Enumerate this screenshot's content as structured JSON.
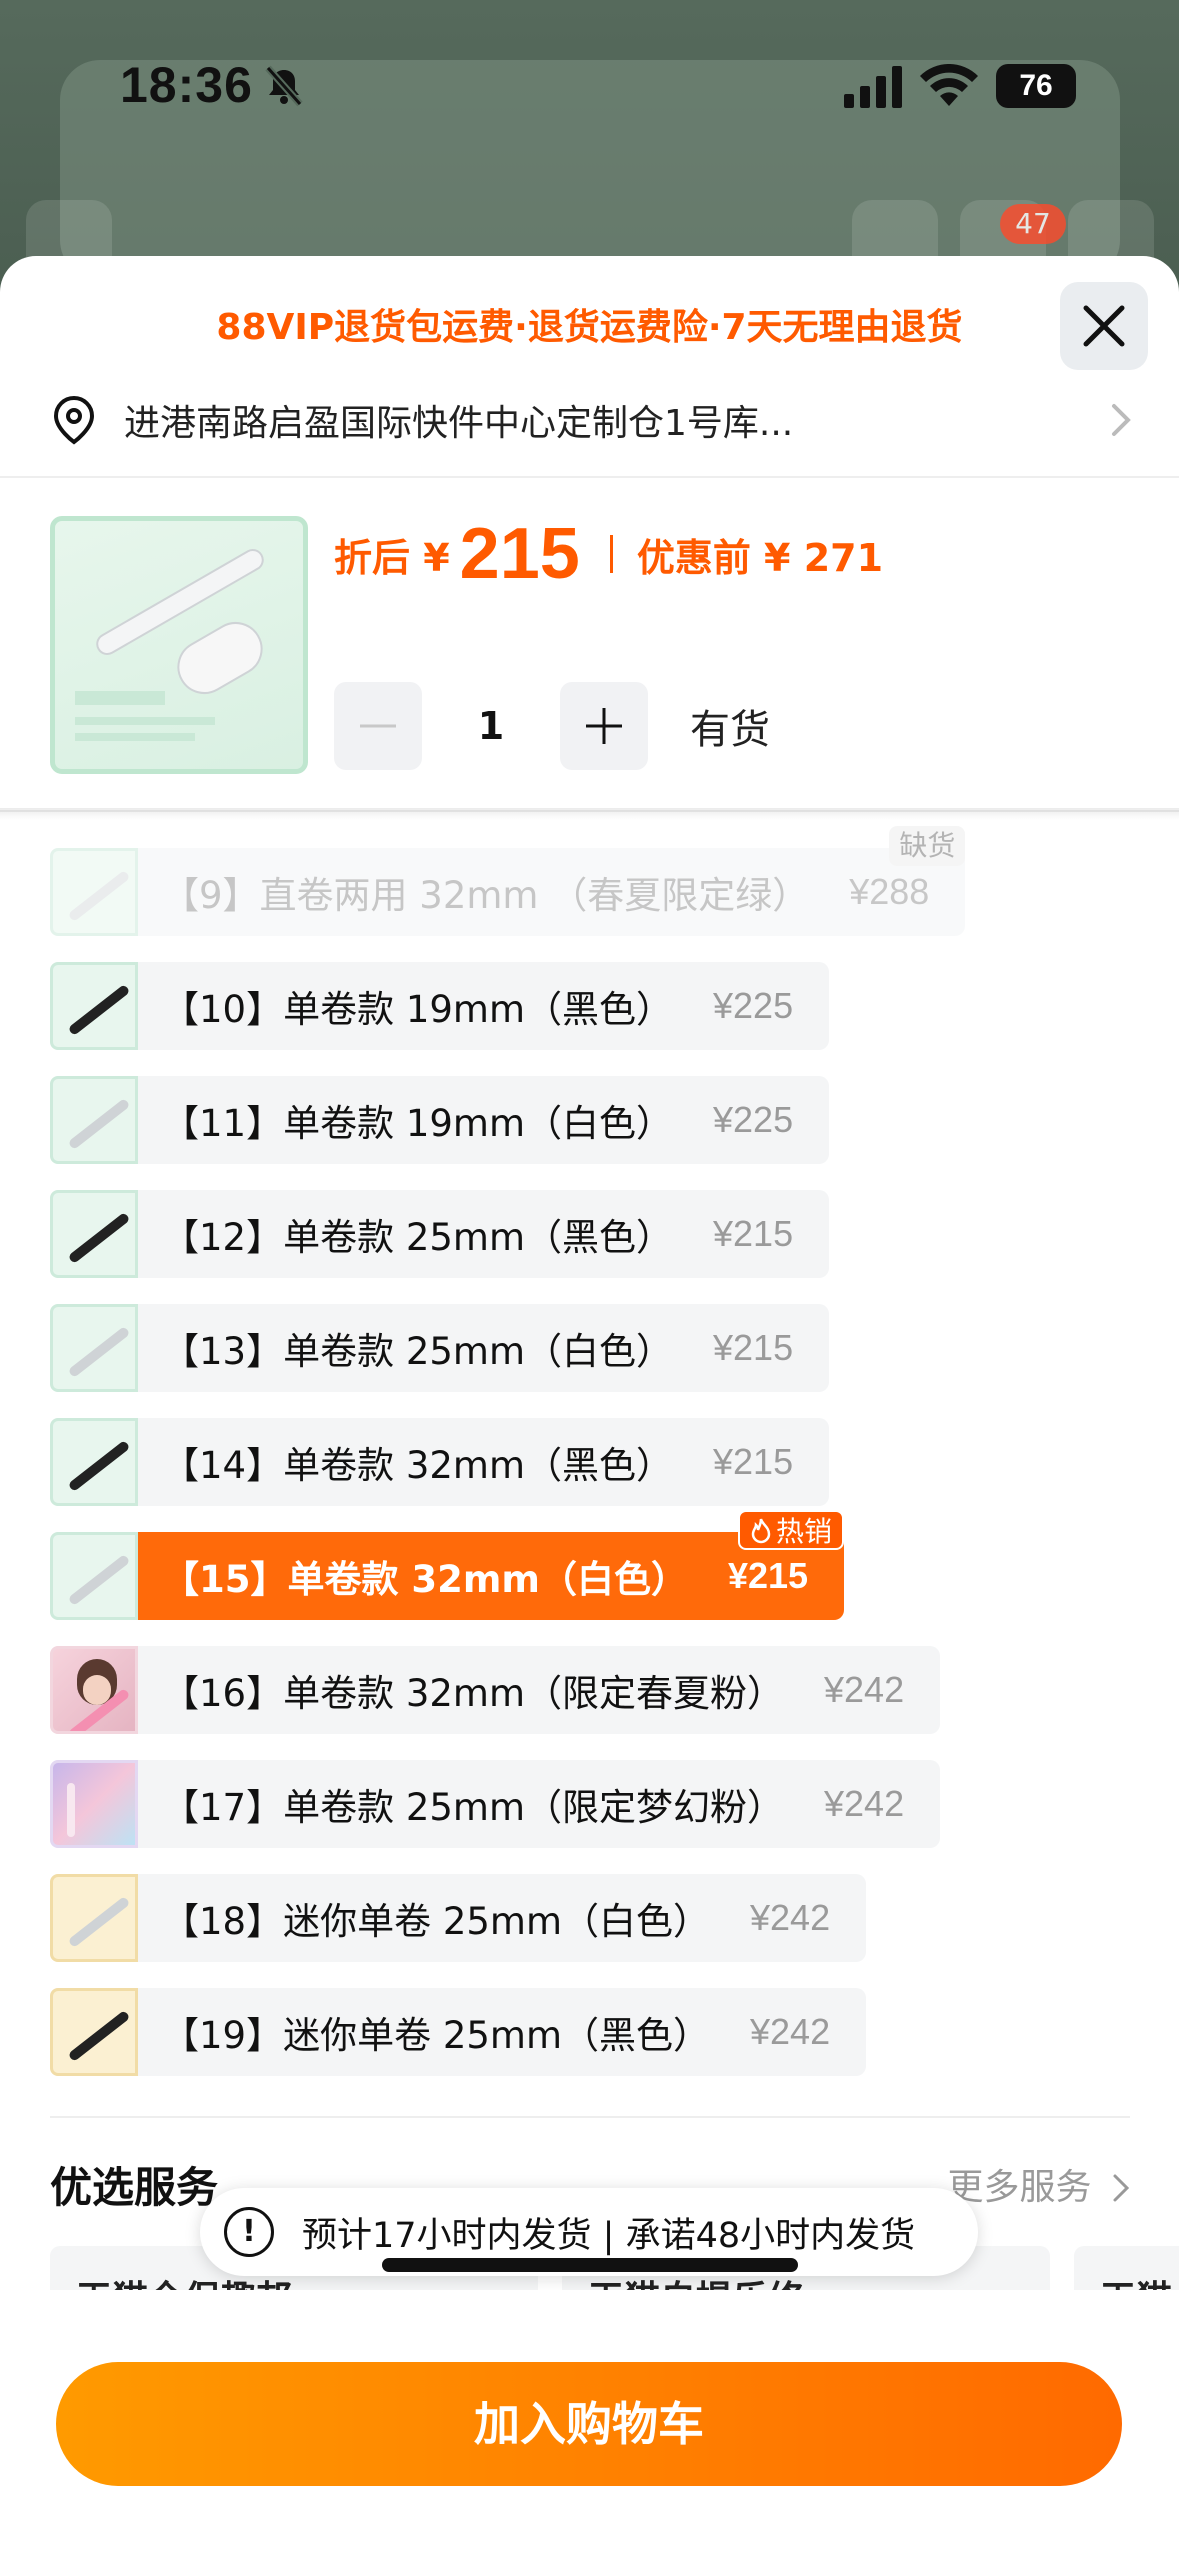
{
  "status_bar": {
    "time": "18:36",
    "battery": "76"
  },
  "background": {
    "cart_count": "47"
  },
  "sheet": {
    "promo": "88VIP退货包运费·退货运费险·7天无理由退货",
    "address": "进港南路启盈国际快件中心定制仓1号库...",
    "price": {
      "after_label": "折后 ¥",
      "after_value": "215",
      "before_label": "优惠前 ¥ 271"
    },
    "quantity": {
      "value": "1",
      "stock": "有货"
    },
    "options": [
      {
        "label": "【9】直卷两用 32mm （春夏限定绿）",
        "price": "¥288",
        "state": "sold",
        "tag": "缺货",
        "thumb": "white"
      },
      {
        "label": "【10】单卷款 19mm（黑色）",
        "price": "¥225",
        "state": "normal",
        "tag": "",
        "thumb": "black"
      },
      {
        "label": "【11】单卷款 19mm（白色）",
        "price": "¥225",
        "state": "normal",
        "tag": "",
        "thumb": "white"
      },
      {
        "label": "【12】单卷款 25mm（黑色）",
        "price": "¥215",
        "state": "normal",
        "tag": "",
        "thumb": "black"
      },
      {
        "label": "【13】单卷款 25mm（白色）",
        "price": "¥215",
        "state": "normal",
        "tag": "",
        "thumb": "white"
      },
      {
        "label": "【14】单卷款 32mm（黑色）",
        "price": "¥215",
        "state": "normal",
        "tag": "",
        "thumb": "black"
      },
      {
        "label": "【15】单卷款 32mm（白色）",
        "price": "¥215",
        "state": "selected",
        "tag": "热销",
        "thumb": "white"
      },
      {
        "label": "【16】单卷款 32mm（限定春夏粉）",
        "price": "¥242",
        "state": "normal",
        "tag": "",
        "thumb": "pink-photo"
      },
      {
        "label": "【17】单卷款 25mm（限定梦幻粉）",
        "price": "¥242",
        "state": "normal",
        "tag": "",
        "thumb": "pastel"
      },
      {
        "label": "【18】迷你单卷 25mm（白色）",
        "price": "¥242",
        "state": "normal",
        "tag": "",
        "thumb": "white-yellow"
      },
      {
        "label": "【19】迷你单卷 25mm（黑色）",
        "price": "¥242",
        "state": "normal",
        "tag": "",
        "thumb": "black-yellow"
      }
    ],
    "services": {
      "title": "优选服务",
      "more": "更多服务",
      "cards": [
        "天猫全保趣邦",
        "天猫自提乐修",
        "天猫"
      ],
      "notice": "预计17小时内发货 | 承诺48小时内发货"
    },
    "cta": "加入购物车"
  },
  "colors": {
    "accent": "#ff6a0a",
    "promo": "#ff5a00"
  },
  "icons": [
    "bell-off-icon",
    "signal-icon",
    "wifi-icon",
    "close-icon",
    "location-pin-icon",
    "chevron-right-icon",
    "minus-icon",
    "plus-icon",
    "flame-icon",
    "exclamation-icon"
  ]
}
